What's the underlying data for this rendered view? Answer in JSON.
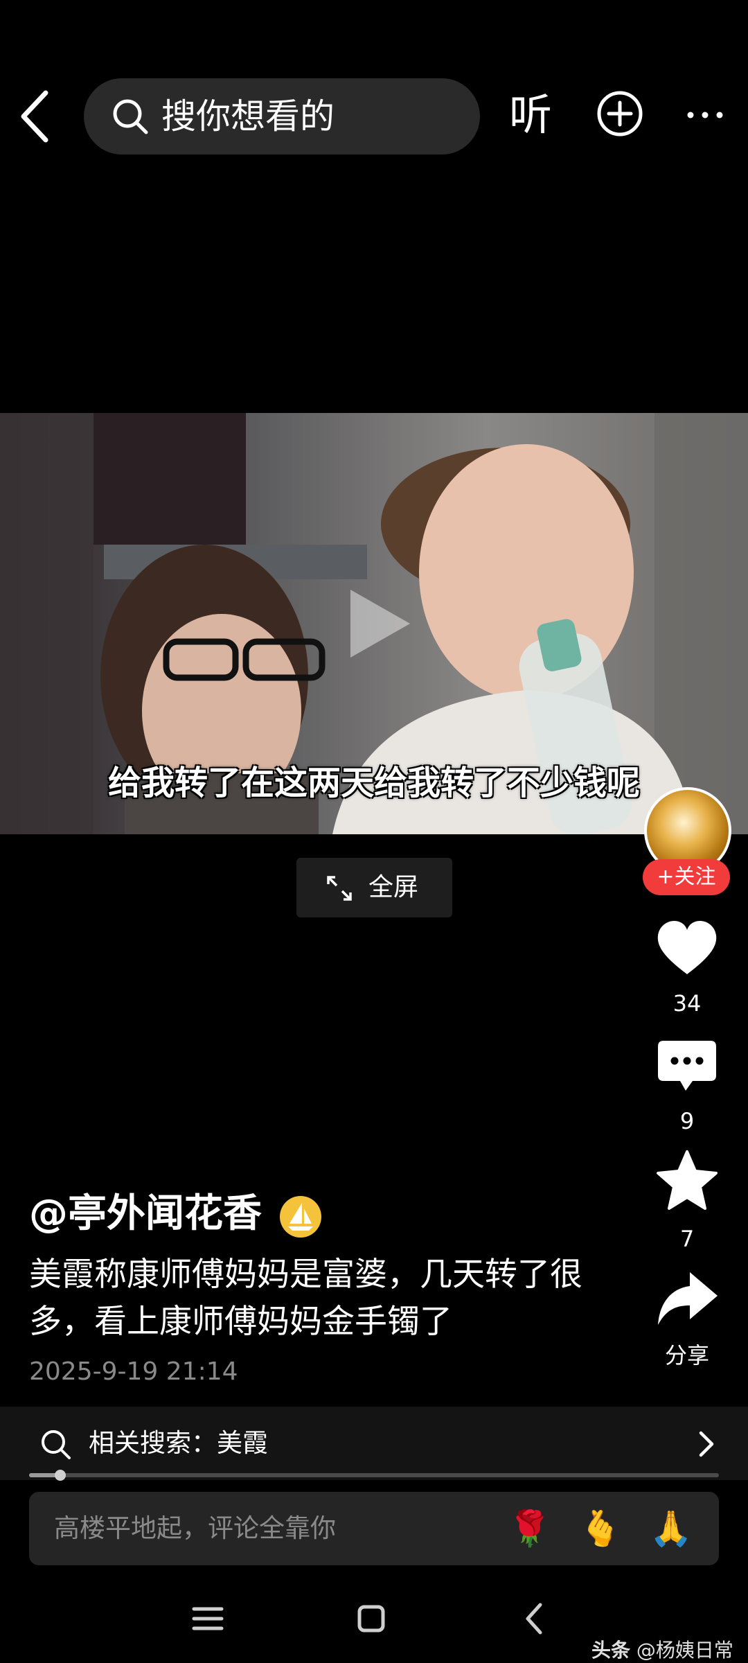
{
  "header": {
    "search_placeholder": "搜你想看的",
    "listen_label": "听"
  },
  "video": {
    "subtitle": "给我转了在这两天给我转了不少钱呢",
    "fullscreen_label": "全屏"
  },
  "actions": {
    "follow_label": "+关注",
    "likes": "34",
    "comments": "9",
    "favorites": "7",
    "share_label": "分享"
  },
  "post": {
    "author": "@亭外闻花香",
    "description": "美霞称康师傅妈妈是富婆，几天转了很多，看上康师傅妈妈金手镯了",
    "timestamp": "2025-9-19 21:14"
  },
  "related": {
    "label": "相关搜索：美霞"
  },
  "progress": {
    "played_fraction": 0.045
  },
  "comment": {
    "placeholder": "高楼平地起，评论全靠你",
    "emojis": [
      "🌹",
      "🫰",
      "🙏"
    ]
  },
  "watermark": {
    "app": "头条",
    "account": "@杨姨日常"
  },
  "colors": {
    "accent_red": "#f23b3b",
    "badge_yellow": "#f5c33b"
  }
}
